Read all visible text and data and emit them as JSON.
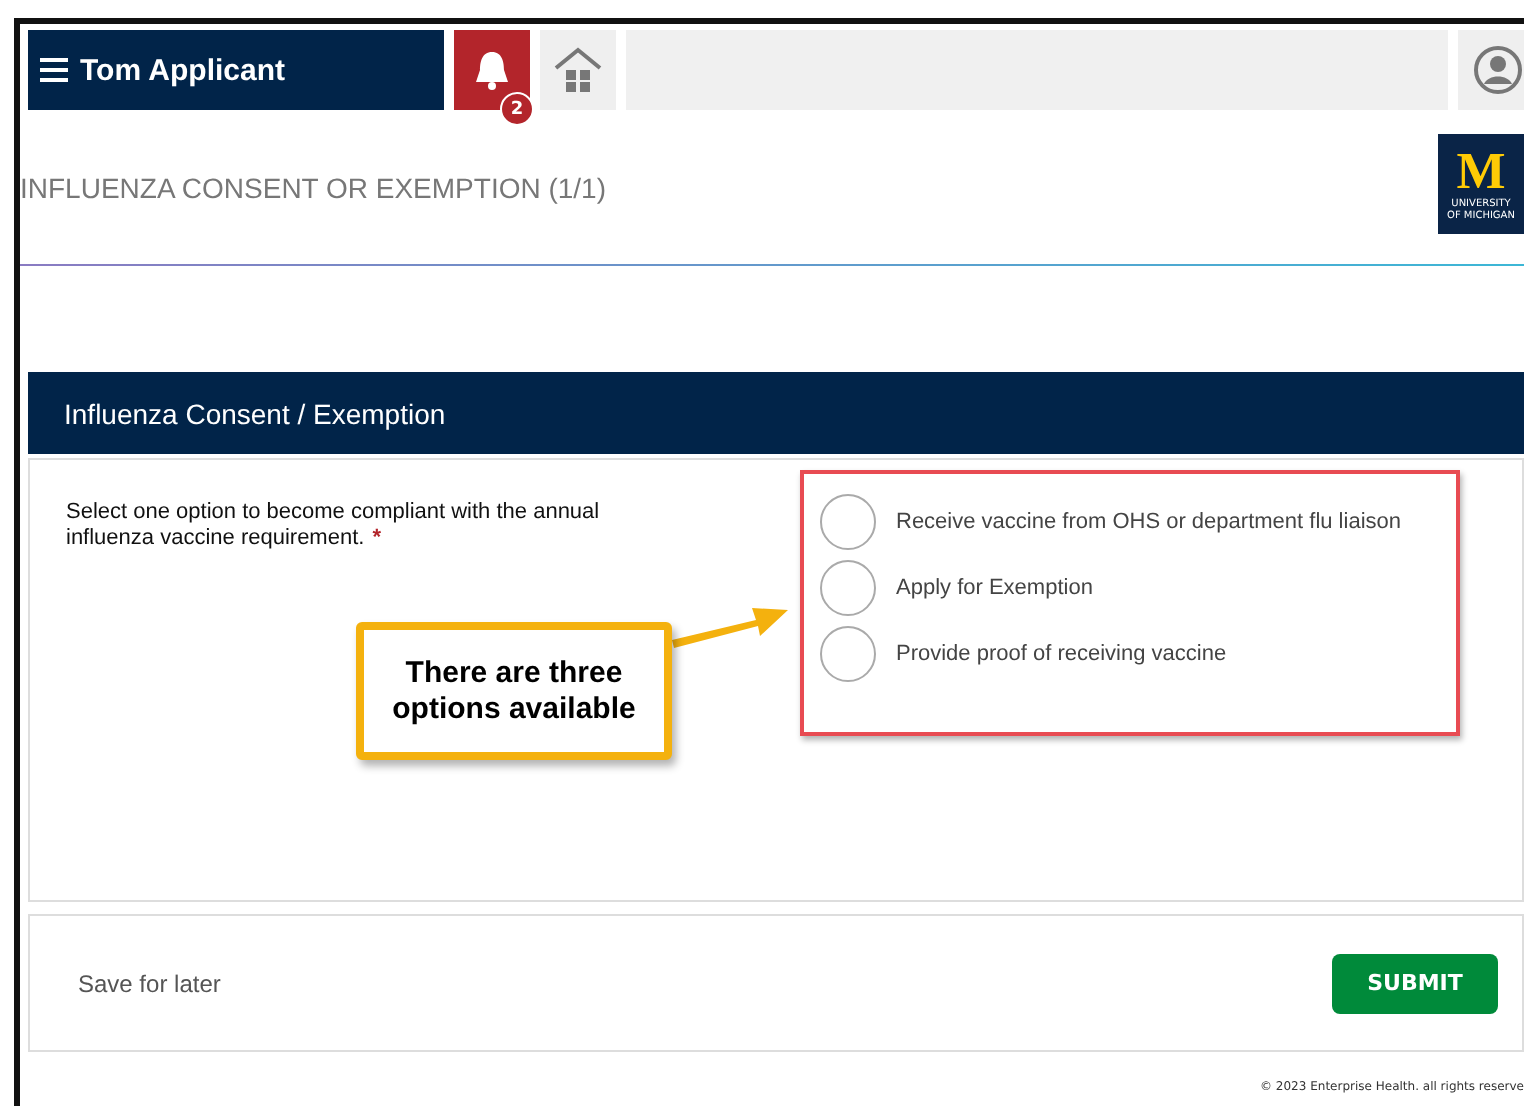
{
  "header": {
    "user_name": "Tom Applicant",
    "notification_count": "2"
  },
  "page_title": "INFLUENZA CONSENT OR EXEMPTION (1/1)",
  "logo": {
    "letter": "M",
    "caption": "UNIVERSITY OF MICHIGAN"
  },
  "section": {
    "title": "Influenza Consent / Exemption",
    "question": "Select one option to become compliant with the annual influenza vaccine requirement.",
    "required_mark": "*",
    "options": [
      {
        "label": "Receive vaccine from OHS or department flu liaison",
        "selected": false
      },
      {
        "label": "Apply for Exemption",
        "selected": false
      },
      {
        "label": "Provide proof of receiving vaccine",
        "selected": false
      }
    ]
  },
  "callout": {
    "text": "There are three options available"
  },
  "footer": {
    "save_link": "Save for later",
    "submit": "SUBMIT"
  },
  "copyright": "© 2023 Enterprise Health. all rights reserve"
}
